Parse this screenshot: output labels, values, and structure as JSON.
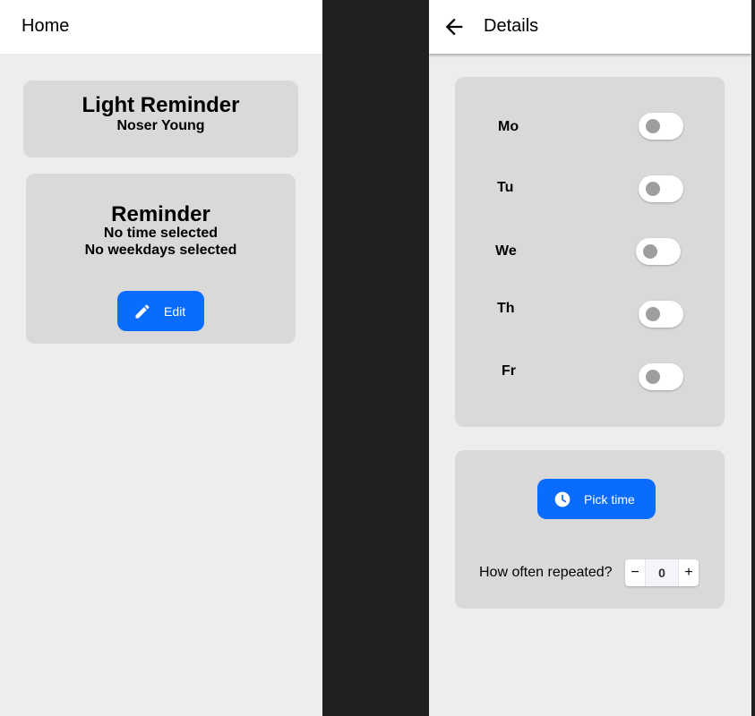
{
  "home": {
    "appbar_title": "Home",
    "title_card": {
      "title": "Light Reminder",
      "subtitle": "Noser Young"
    },
    "reminder_card": {
      "title": "Reminder",
      "time_status": "No time selected",
      "weekday_status": "No weekdays selected",
      "edit_label": "Edit"
    }
  },
  "details": {
    "appbar_title": "Details",
    "weekdays": [
      {
        "label": "Mo",
        "enabled": false
      },
      {
        "label": "Tu",
        "enabled": false
      },
      {
        "label": "We",
        "enabled": false
      },
      {
        "label": "Th",
        "enabled": false
      },
      {
        "label": "Fr",
        "enabled": false
      }
    ],
    "pick_time_label": "Pick time",
    "repeat_label": "How often repeated?",
    "repeat_count": "0",
    "stepper_minus": "−",
    "stepper_plus": "+"
  },
  "colors": {
    "accent": "#0a6cff",
    "card": "#d9d9d9",
    "background": "#ededed",
    "divider": "#202020",
    "toggle_knob_off": "#9e9e9e"
  }
}
